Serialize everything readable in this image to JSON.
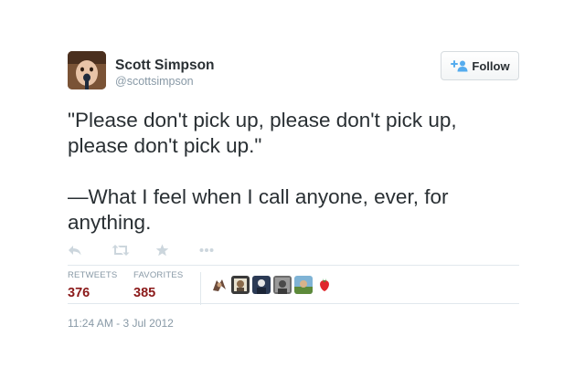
{
  "user": {
    "full_name": "Scott Simpson",
    "screen_name": "@scottsimpson"
  },
  "follow": {
    "label": "Follow",
    "icon": "add-user-icon"
  },
  "tweet": {
    "paragraph_1": "\"Please don't pick up, please don't pick up, please don't pick up.\"",
    "paragraph_2": "—What I feel when I call anyone, ever, for anything."
  },
  "actions": [
    "reply-icon",
    "retweet-icon",
    "favorite-icon",
    "more-icon"
  ],
  "stats": {
    "retweets_label": "RETWEETS",
    "retweets_count": "376",
    "favorites_label": "FAVORITES",
    "favorites_count": "385"
  },
  "timestamp": "11:24 AM - 3 Jul 2012",
  "colors": {
    "accent": "#55acee",
    "count": "#8b1a1a",
    "muted": "#8899a6",
    "divider": "#e1e8ed"
  }
}
